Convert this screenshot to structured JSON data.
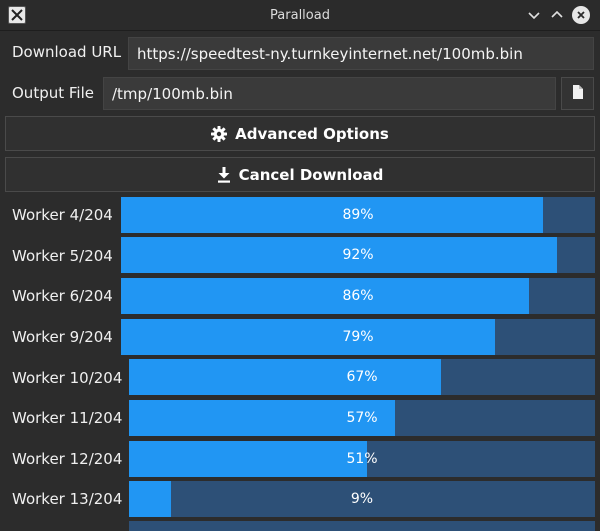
{
  "window": {
    "title": "Paralload",
    "controls": [
      "minimize-icon",
      "maximize-icon",
      "close-icon"
    ]
  },
  "download_url": {
    "label": "Download URL",
    "value": "https://speedtest-ny.turnkeyinternet.net/100mb.bin"
  },
  "output_file": {
    "label": "Output File",
    "value": "/tmp/100mb.bin",
    "browse_icon": "file-icon"
  },
  "advanced_button": {
    "label": "Advanced Options",
    "icon": "gear-icon"
  },
  "cancel_button": {
    "label": "Cancel Download",
    "icon": "download-icon"
  },
  "colors": {
    "progress_fill": "#2196f3",
    "progress_track": "#2d5077",
    "background": "#2c2c2c"
  },
  "workers": [
    {
      "label": "Worker 4/204",
      "progress_text": "89%",
      "progress": 0.89
    },
    {
      "label": "Worker 5/204",
      "progress_text": "92%",
      "progress": 0.92
    },
    {
      "label": "Worker 6/204",
      "progress_text": "86%",
      "progress": 0.86
    },
    {
      "label": "Worker 9/204",
      "progress_text": "79%",
      "progress": 0.79
    },
    {
      "label": "Worker 10/204",
      "progress_text": "67%",
      "progress": 0.67
    },
    {
      "label": "Worker 11/204",
      "progress_text": "57%",
      "progress": 0.57
    },
    {
      "label": "Worker 12/204",
      "progress_text": "51%",
      "progress": 0.51
    },
    {
      "label": "Worker 13/204",
      "progress_text": "9%",
      "progress": 0.09
    }
  ]
}
